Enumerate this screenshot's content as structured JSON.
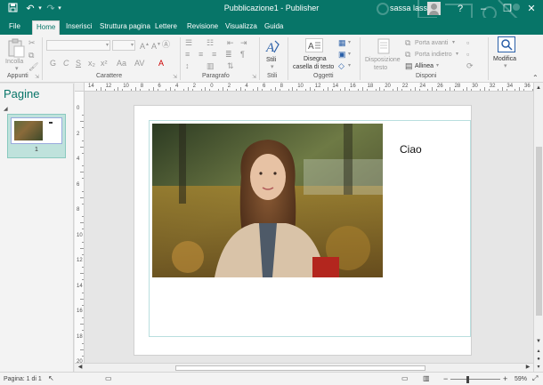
{
  "titlebar": {
    "title": "Pubblicazione1  -  Publisher",
    "user": "sassa lassa",
    "help": "?"
  },
  "tabs": [
    "File",
    "Home",
    "Inserisci",
    "Struttura pagina",
    "Lettere",
    "Revisione",
    "Visualizza",
    "Guida"
  ],
  "ribbon": {
    "groups": {
      "appunti": "Appunti",
      "carattere": "Carattere",
      "paragrafo": "Paragrafo",
      "stili": "Stili",
      "oggetti": "Oggetti",
      "disponi": "Disponi"
    },
    "incolla": "Incolla",
    "stili_btn": "Stili",
    "disegna_line1": "Disegna",
    "disegna_line2": "casella di testo",
    "disposizione_line1": "Disposizione",
    "disposizione_line2": "testo",
    "porta_avanti": "Porta avanti",
    "porta_indietro": "Porta indietro",
    "allinea": "Allinea",
    "modifica": "Modifica",
    "format_glyphs": [
      "G",
      "C",
      "S",
      "x₂",
      "x²",
      "AV",
      "A"
    ]
  },
  "pages_panel": {
    "title": "Pagine",
    "thumb_number": "1"
  },
  "ruler": {
    "h_labels": [
      "14",
      "12",
      "10",
      "8",
      "6",
      "4",
      "2",
      "0",
      "2",
      "4",
      "6",
      "8",
      "10",
      "12",
      "14",
      "16",
      "18",
      "20",
      "22",
      "24",
      "26",
      "28",
      "30",
      "32",
      "34",
      "36"
    ],
    "v_labels": [
      "0",
      "2",
      "4",
      "6",
      "8",
      "10",
      "12",
      "14",
      "16",
      "18",
      "20"
    ]
  },
  "document": {
    "text_box": "Ciao"
  },
  "statusbar": {
    "page": "Pagina: 1 di 1",
    "zoom": "59%",
    "zoom_minus": "−",
    "zoom_plus": "+"
  },
  "colors": {
    "accent": "#077568",
    "ribbon_bg": "#f3f3f3",
    "canvas_bg": "#e6e6e6"
  }
}
